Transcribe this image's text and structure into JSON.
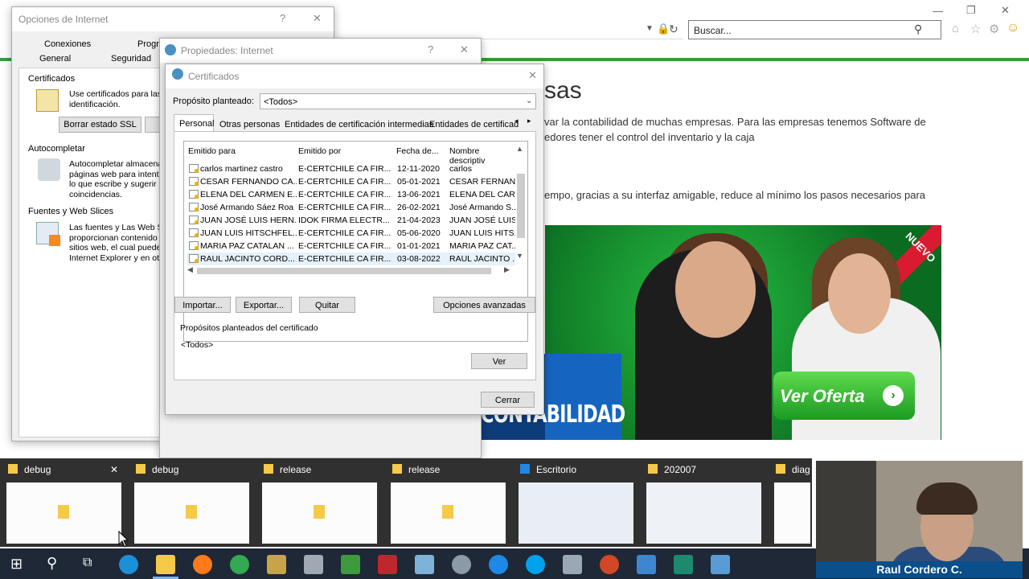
{
  "browser": {
    "search_placeholder": "Buscar...",
    "min_icon": "—",
    "restore_icon": "❐",
    "close_icon": "✕"
  },
  "webpage": {
    "heading_fragment": "sas",
    "para1_line1": "var la contabilidad de muchas empresas. Para las empresas tenemos Software de",
    "para1_line2": "edores tener el control del inventario y la caja",
    "para2": "empo, gracias a su interfaz amigable, reduce al mínimo los pasos necesarios para",
    "banner_left_text": "CONTABILIDAD",
    "ribbon_text": "NUEVO",
    "cta_label": "Ver Oferta",
    "cta_arrow": "›"
  },
  "opciones_dialog": {
    "title": "Opciones de Internet",
    "help": "?",
    "close": "✕",
    "tabs_row1": [
      "Conexiones",
      "Progr"
    ],
    "tabs_row2": [
      "General",
      "Seguridad"
    ],
    "certificados_label": "Certificados",
    "certificados_text": [
      "Use certificados para las",
      "identificación."
    ],
    "borrar_ssl": "Borrar estado SSL",
    "autocompletar_label": "Autocompletar",
    "autocompletar_text": [
      "Autocompletar almacena",
      "páginas web para intenta",
      "lo que escribe y sugerir p",
      "coincidencias."
    ],
    "fuentes_label": "Fuentes y Web Slices",
    "fuentes_text": [
      "Las fuentes y Las Web Sli",
      "proporcionan contenido a",
      "sitios web, el cual puede",
      "Internet Explorer y en ot"
    ]
  },
  "propiedades_dialog": {
    "title": "Propiedades: Internet",
    "help": "?",
    "close": "✕"
  },
  "cert_dialog": {
    "title": "Certificados",
    "close": "✕",
    "proposito_label": "Propósito planteado:",
    "proposito_value": "<Todos>",
    "tabs": [
      "Personal",
      "Otras personas",
      "Entidades de certificación intermedias",
      "Entidades de certificad"
    ],
    "columns": [
      "Emitido para",
      "Emitido por",
      "Fecha de...",
      "Nombre descriptiv"
    ],
    "rows": [
      [
        "carlos martinez castro",
        "E-CERTCHILE CA FIR...",
        "12-11-2020",
        "carlos"
      ],
      [
        "CESAR FERNANDO CA...",
        "E-CERTCHILE CA FIR...",
        "05-01-2021",
        "CESAR FERNAN..."
      ],
      [
        "ELENA DEL CARMEN E...",
        "E-CERTCHILE CA FIR...",
        "13-06-2021",
        "ELENA DEL CAR..."
      ],
      [
        "José Armando Sáez Roa",
        "E-CERTCHILE CA FIR...",
        "26-02-2021",
        "José Armando S..."
      ],
      [
        "JUAN JOSÉ LUIS HERN...",
        "IDOK FIRMA ELECTR...",
        "21-04-2023",
        "JUAN JOSÉ LUIS..."
      ],
      [
        "JUAN LUIS HITSCHFEL...",
        "E-CERTCHILE CA FIR...",
        "05-06-2020",
        "JUAN LUIS HITS..."
      ],
      [
        "MARIA PAZ CATALAN ...",
        "E-CERTCHILE CA FIR...",
        "01-01-2021",
        "MARIA PAZ CAT..."
      ],
      [
        "RAUL JACINTO CORD...",
        "E-CERTCHILE CA FIR...",
        "03-08-2022",
        "RAUL JACINTO ..."
      ]
    ],
    "importar": "Importar...",
    "exportar": "Exportar...",
    "quitar": "Quitar",
    "opciones_avanzadas": "Opciones avanzadas",
    "propositos_label": "Propósitos planteados del certificado",
    "propositos_value": "<Todos>",
    "ver": "Ver",
    "cerrar": "Cerrar"
  },
  "task_switcher": {
    "items": [
      "debug",
      "debug",
      "release",
      "release",
      "Escritorio",
      "202007",
      "diag"
    ],
    "close_icon": "✕"
  },
  "webcam": {
    "name": "Raul Cordero C."
  }
}
